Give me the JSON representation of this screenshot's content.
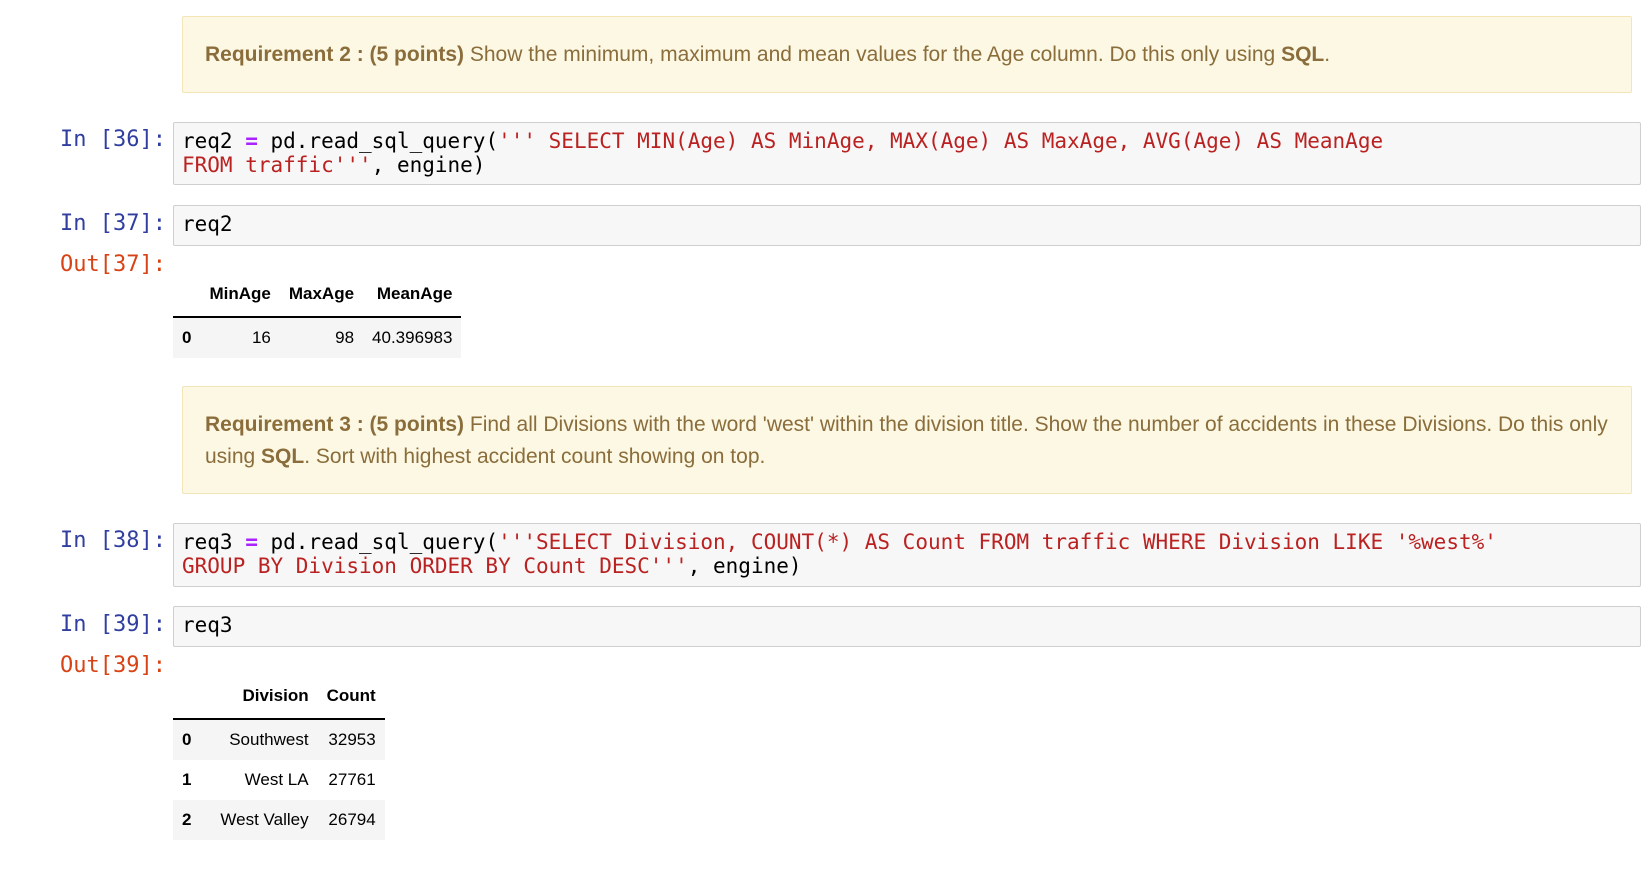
{
  "req2_markdown": {
    "bold_label": "Requirement 2 : (5 points)",
    "text_before": " Show the minimum, maximum and mean values for the Age column. Do this only using ",
    "bold_sql": "SQL",
    "text_after": "."
  },
  "cell36": {
    "prompt": "In [36]:",
    "line1": {
      "var": "req2 ",
      "op": "=",
      "call": " pd.read_sql_query(",
      "str": "''' SELECT MIN(Age) AS MinAge, MAX(Age) AS MaxAge, AVG(Age) AS MeanAge"
    },
    "line2": {
      "str": "FROM traffic'''",
      "rest": ", engine)"
    }
  },
  "cell37": {
    "prompt": "In [37]:",
    "code": "req2",
    "out_prompt": "Out[37]:",
    "table": {
      "columns": [
        "",
        "MinAge",
        "MaxAge",
        "MeanAge"
      ],
      "rows": [
        [
          "0",
          "16",
          "98",
          "40.396983"
        ]
      ]
    }
  },
  "req3_markdown": {
    "bold_label": "Requirement 3 : (5 points)",
    "text_before": " Find all Divisions with the word 'west' within the division title. Show the number of accidents in these Divisions. Do this only using ",
    "bold_sql": "SQL",
    "text_after": ". Sort with highest accident count showing on top."
  },
  "cell38": {
    "prompt": "In [38]:",
    "line1": {
      "var": "req3 ",
      "op": "=",
      "call": " pd.read_sql_query(",
      "str": "'''SELECT Division, COUNT(*) AS Count FROM traffic WHERE Division LIKE '%west%'"
    },
    "line2": {
      "str": "GROUP BY Division ORDER BY Count DESC'''",
      "rest": ", engine)"
    }
  },
  "cell39": {
    "prompt": "In [39]:",
    "code": "req3",
    "out_prompt": "Out[39]:",
    "table": {
      "columns": [
        "",
        "Division",
        "Count"
      ],
      "rows": [
        [
          "0",
          "Southwest",
          "32953"
        ],
        [
          "1",
          "West LA",
          "27761"
        ],
        [
          "2",
          "West Valley",
          "26794"
        ]
      ]
    }
  }
}
